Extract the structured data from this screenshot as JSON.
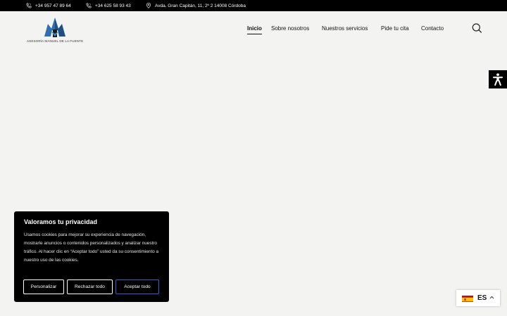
{
  "topbar": {
    "phone1": "+34 957 47 89 64",
    "phone2": "+34 625 58 93 43",
    "address": "Avda. Gran Capitán, 11, 2º 2 14008 Córdoba"
  },
  "header": {
    "logo_text": "ASESORÍA MANUEL DE LA FUENTE",
    "nav": [
      {
        "label": "Inicio",
        "active": true
      },
      {
        "label": "Sobre nosotros"
      },
      {
        "label": "Nuestros servicios"
      },
      {
        "label": "Pide tu cita"
      },
      {
        "label": "Contacto"
      }
    ],
    "search_icon": "search-icon"
  },
  "accessibility": {
    "icon": "accessibility-icon"
  },
  "cookie": {
    "title": "Valoramos tu privacidad",
    "text": "Usamos cookies para mejorar su experiencia de navegación, mostrarle anuncios o contenidos personalizados y analizar nuestro tráfico. Al hacer clic en “Aceptar todo” usted da su consentimiento a nuestro uso de las cookies.",
    "buttons": {
      "customize": "Personalizar",
      "reject": "Rechazar todo",
      "accept": "Aceptar todo"
    }
  },
  "language": {
    "code": "ES",
    "flag": "spain-flag-icon"
  },
  "colors": {
    "topbar_bg": "#000000",
    "page_bg": "#f3f4f2",
    "accept_border": "#3b5bd6"
  }
}
